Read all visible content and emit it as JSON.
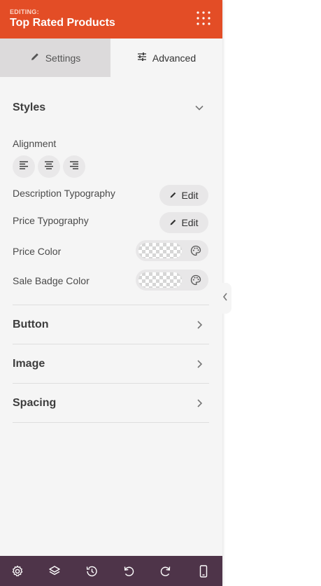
{
  "header": {
    "editing_label": "EDITING:",
    "title": "Top Rated Products"
  },
  "tabs": [
    {
      "label": "Settings"
    },
    {
      "label": "Advanced"
    }
  ],
  "styles": {
    "title": "Styles",
    "alignment_label": "Alignment",
    "desc_typography_label": "Description Typography",
    "price_typography_label": "Price Typography",
    "price_color_label": "Price Color",
    "sale_badge_color_label": "Sale Badge Color",
    "edit_label": "Edit"
  },
  "sections": [
    {
      "title": "Button"
    },
    {
      "title": "Image"
    },
    {
      "title": "Spacing"
    }
  ],
  "footer_icons": [
    "gear-icon",
    "layers-icon",
    "history-icon",
    "undo-icon",
    "redo-icon",
    "mobile-icon"
  ],
  "colors": {
    "header": "#e34d26",
    "footer": "#4e3449"
  }
}
